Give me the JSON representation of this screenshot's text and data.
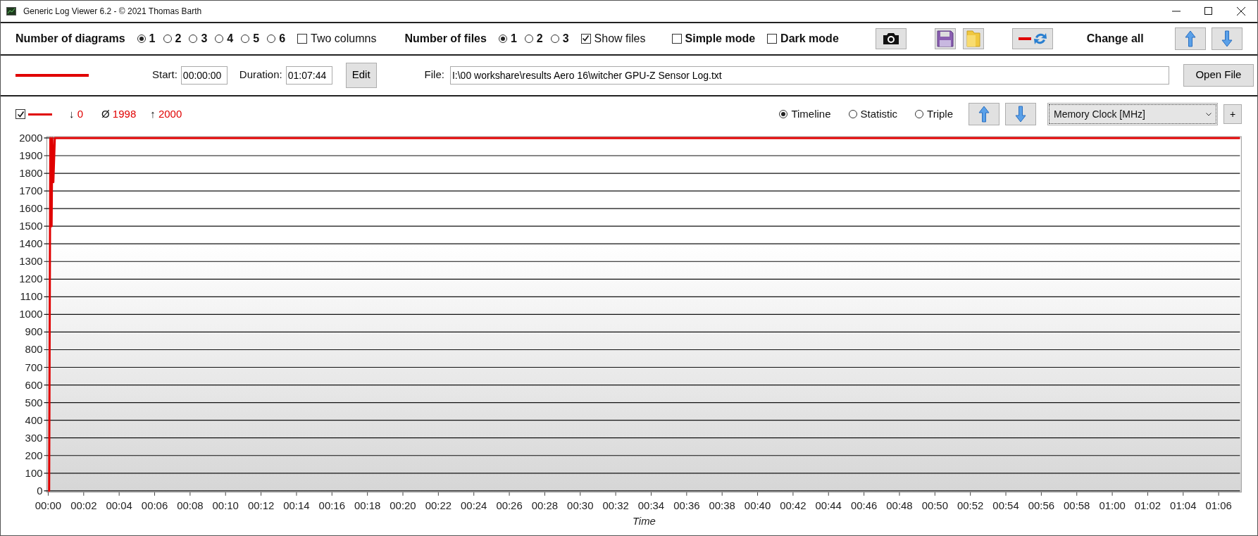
{
  "window": {
    "title": "Generic Log Viewer 6.2 - © 2021 Thomas Barth"
  },
  "toolbar": {
    "diagrams_label": "Number of diagrams",
    "diagram_options": [
      {
        "label": "1",
        "selected": true
      },
      {
        "label": "2",
        "selected": false
      },
      {
        "label": "3",
        "selected": false
      },
      {
        "label": "4",
        "selected": false
      },
      {
        "label": "5",
        "selected": false
      },
      {
        "label": "6",
        "selected": false
      }
    ],
    "two_columns": {
      "label": "Two columns",
      "checked": false
    },
    "files_label": "Number of files",
    "file_options": [
      {
        "label": "1",
        "selected": true
      },
      {
        "label": "2",
        "selected": false
      },
      {
        "label": "3",
        "selected": false
      }
    ],
    "show_files": {
      "label": "Show files",
      "checked": true
    },
    "simple_mode": {
      "label": "Simple mode",
      "checked": false
    },
    "dark_mode": {
      "label": "Dark mode",
      "checked": false
    },
    "change_all_label": "Change all"
  },
  "file_row": {
    "start_label": "Start:",
    "start": "00:00:00",
    "duration_label": "Duration:",
    "duration": "01:07:44",
    "edit_button": "Edit",
    "file_label": "File:",
    "file_path": "I:\\00 workshare\\results Aero 16\\witcher GPU-Z Sensor Log.txt",
    "open_button": "Open File"
  },
  "diagram": {
    "visible": true,
    "min_symbol": "↓",
    "min": "0",
    "avg_symbol": "Ø",
    "avg": "1998",
    "max_symbol": "↑",
    "max": "2000",
    "view_modes": [
      {
        "label": "Timeline",
        "selected": true
      },
      {
        "label": "Statistic",
        "selected": false
      },
      {
        "label": "Triple",
        "selected": false
      }
    ],
    "add_button": "+",
    "chart_data": {
      "type": "line",
      "xlabel": "Time",
      "grid": true,
      "x": [
        0,
        0.05,
        0.12,
        0.19,
        0.23,
        0.29,
        0.37,
        67.2
      ],
      "series": [
        {
          "name": "Memory Clock [MHz]",
          "color": "#e00000",
          "values": [
            0,
            0,
            2000,
            1500,
            2000,
            1750,
            2000,
            2000
          ]
        }
      ],
      "xlim": [
        0,
        67.2
      ],
      "ylim": [
        0,
        2000
      ],
      "xticks": [
        {
          "value": 0,
          "label": "00:00"
        },
        {
          "value": 2,
          "label": "00:02"
        },
        {
          "value": 4,
          "label": "00:04"
        },
        {
          "value": 6,
          "label": "00:06"
        },
        {
          "value": 8,
          "label": "00:08"
        },
        {
          "value": 10,
          "label": "00:10"
        },
        {
          "value": 12,
          "label": "00:12"
        },
        {
          "value": 14,
          "label": "00:14"
        },
        {
          "value": 16,
          "label": "00:16"
        },
        {
          "value": 18,
          "label": "00:18"
        },
        {
          "value": 20,
          "label": "00:20"
        },
        {
          "value": 22,
          "label": "00:22"
        },
        {
          "value": 24,
          "label": "00:24"
        },
        {
          "value": 26,
          "label": "00:26"
        },
        {
          "value": 28,
          "label": "00:28"
        },
        {
          "value": 30,
          "label": "00:30"
        },
        {
          "value": 32,
          "label": "00:32"
        },
        {
          "value": 34,
          "label": "00:34"
        },
        {
          "value": 36,
          "label": "00:36"
        },
        {
          "value": 38,
          "label": "00:38"
        },
        {
          "value": 40,
          "label": "00:40"
        },
        {
          "value": 42,
          "label": "00:42"
        },
        {
          "value": 44,
          "label": "00:44"
        },
        {
          "value": 46,
          "label": "00:46"
        },
        {
          "value": 48,
          "label": "00:48"
        },
        {
          "value": 50,
          "label": "00:50"
        },
        {
          "value": 52,
          "label": "00:52"
        },
        {
          "value": 54,
          "label": "00:54"
        },
        {
          "value": 56,
          "label": "00:56"
        },
        {
          "value": 58,
          "label": "00:58"
        },
        {
          "value": 60,
          "label": "01:00"
        },
        {
          "value": 62,
          "label": "01:02"
        },
        {
          "value": 64,
          "label": "01:04"
        },
        {
          "value": 66,
          "label": "01:06"
        }
      ],
      "yticks": [
        0,
        100,
        200,
        300,
        400,
        500,
        600,
        700,
        800,
        900,
        1000,
        1100,
        1200,
        1300,
        1400,
        1500,
        1600,
        1700,
        1800,
        1900,
        2000
      ]
    }
  }
}
